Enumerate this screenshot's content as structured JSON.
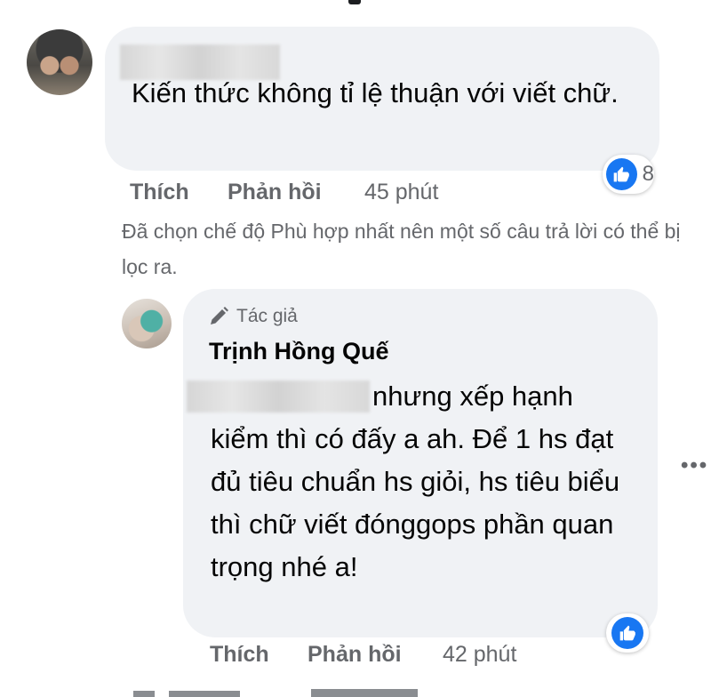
{
  "comment1": {
    "text": "Kiến thức không tỉ lệ thuận với viết chữ.",
    "reaction_count": "8",
    "actions": {
      "like": "Thích",
      "reply": "Phản hồi",
      "time": "45 phút"
    }
  },
  "filter_notice": "Đã chọn chế độ Phù hợp nhất nên một số câu trả lời có thể bị lọc ra.",
  "reply1": {
    "author_badge": "Tác giả",
    "author_name": "Trịnh Hồng Quế",
    "text": "nhưng xếp hạnh kiểm thì có đấy a ah. Để 1 hs đạt đủ tiêu chuẩn hs giỏi, hs tiêu biểu thì chữ viết đónggops phần quan trọng nhé a!",
    "actions": {
      "like": "Thích",
      "reply": "Phản hồi",
      "time": "42 phút"
    }
  },
  "more_menu": "•••",
  "colors": {
    "accent": "#1877f2",
    "bubble": "#f0f2f5",
    "muted": "#65676b"
  }
}
